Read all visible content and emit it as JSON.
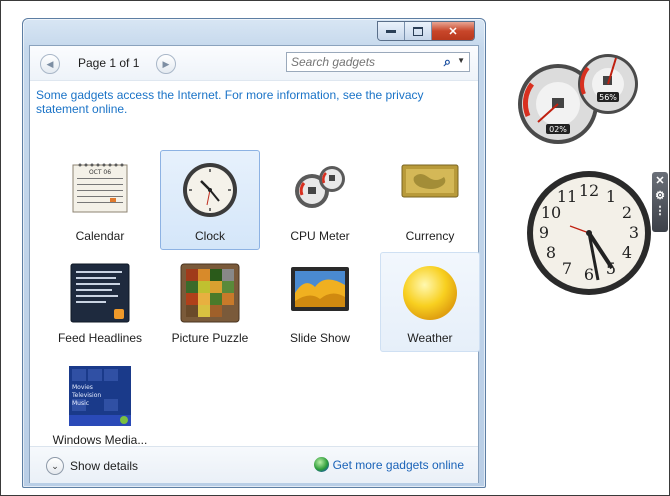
{
  "toolbar": {
    "page_label": "Page 1 of 1",
    "search_placeholder": "Search gadgets"
  },
  "info": {
    "line1": "Some gadgets access the Internet.  For more information, see the privacy",
    "line2": "statement online."
  },
  "gadgets": [
    {
      "label": "Calendar",
      "icon": "calendar-icon",
      "state": "normal"
    },
    {
      "label": "Clock",
      "icon": "clock-icon",
      "state": "selected"
    },
    {
      "label": "CPU Meter",
      "icon": "cpu-meter-icon",
      "state": "normal"
    },
    {
      "label": "Currency",
      "icon": "currency-icon",
      "state": "normal"
    },
    {
      "label": "Feed Headlines",
      "icon": "feed-headlines-icon",
      "state": "normal"
    },
    {
      "label": "Picture Puzzle",
      "icon": "picture-puzzle-icon",
      "state": "normal"
    },
    {
      "label": "Slide Show",
      "icon": "slide-show-icon",
      "state": "normal"
    },
    {
      "label": "Weather",
      "icon": "weather-icon",
      "state": "hovered"
    },
    {
      "label": "Windows Media...",
      "icon": "windows-media-icon",
      "state": "normal"
    }
  ],
  "calendar_thumb": {
    "month": "OCT 06"
  },
  "media_thumb": {
    "items": [
      "Movies",
      "Television",
      "Music"
    ]
  },
  "footer": {
    "show_details": "Show details",
    "get_more": "Get more gadgets online"
  },
  "desktop": {
    "cpu_usage": "02%",
    "memory_usage": "56%",
    "clock_numbers": [
      "12",
      "1",
      "2",
      "3",
      "4",
      "5",
      "6",
      "7",
      "8",
      "9",
      "10",
      "11"
    ]
  },
  "colors": {
    "link": "#1a73c7",
    "selection": "#d4e6f9",
    "close_button": "#c8462a"
  }
}
